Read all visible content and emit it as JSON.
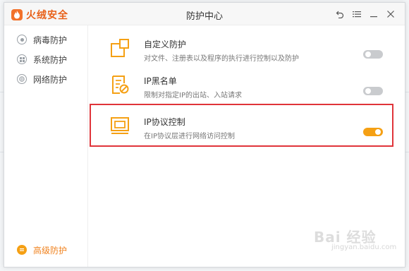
{
  "app": {
    "logo_text": "火绒安全",
    "window_title": "防护中心"
  },
  "titlebar": {
    "icons": [
      "back-icon",
      "menu-icon",
      "minimize-icon",
      "close-icon"
    ]
  },
  "sidebar": {
    "items": [
      {
        "label": "病毒防护",
        "icon": "virus-shield-icon",
        "active": false
      },
      {
        "label": "系统防护",
        "icon": "system-grid-icon",
        "active": false
      },
      {
        "label": "网络防护",
        "icon": "network-globe-icon",
        "active": false
      }
    ],
    "bottom_item": {
      "label": "高级防护",
      "icon": "advanced-shield-icon",
      "active": true
    }
  },
  "main": {
    "rows": [
      {
        "title": "自定义防护",
        "desc": "对文件、注册表以及程序的执行进行控制以及防护",
        "icon": "custom-protection-icon",
        "enabled": false
      },
      {
        "title": "IP黑名单",
        "desc": "限制对指定IP的出站、入站请求",
        "icon": "ip-blacklist-icon",
        "enabled": false
      },
      {
        "title": "IP协议控制",
        "desc": "在IP协议层进行网络访问控制",
        "icon": "ip-protocol-icon",
        "enabled": true
      }
    ]
  },
  "colors": {
    "accent": "#f5a014",
    "brand": "#e8611a",
    "highlight": "#e0343a",
    "toggle_off": "#c9cbce"
  },
  "watermark": {
    "text": "Bai 经验",
    "sub": "jingyan.baidu.com"
  }
}
